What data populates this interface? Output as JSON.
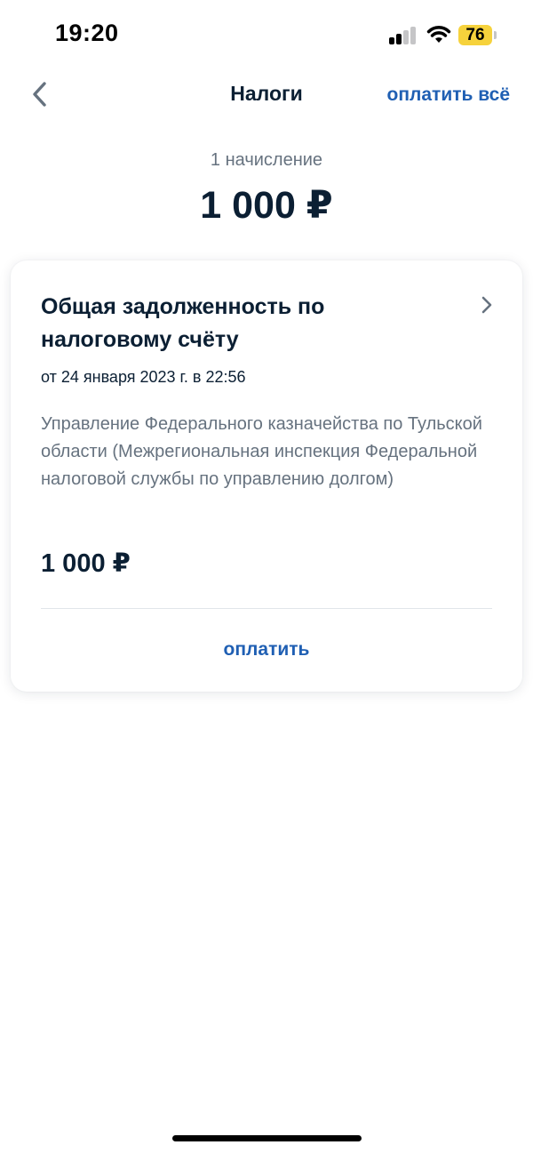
{
  "status_bar": {
    "time": "19:20",
    "battery_level": "76",
    "signal_bars_active": 2,
    "signal_bars_total": 4,
    "icons": [
      "cellular-signal-icon",
      "wifi-icon",
      "battery-icon"
    ],
    "battery_color": "#f6d23c"
  },
  "header": {
    "back_icon": "chevron-left-icon",
    "title": "Налоги",
    "pay_all_label": "оплатить всё"
  },
  "summary": {
    "accruals_label": "1 начисление",
    "total_amount": "1 000 ₽"
  },
  "charge": {
    "title": "Общая задолженность по налоговому счёту",
    "date": "от 24 января 2023 г. в 22:56",
    "recipient": "Управление Федерального казначейства по Тульской области (Межрегиональная инспекция Федеральной налоговой службы по управлению долгом)",
    "amount": "1 000 ₽",
    "pay_label": "оплатить",
    "chevron_icon": "chevron-right-icon"
  },
  "colors": {
    "accent": "#1f5fb3",
    "text_primary": "#0b1f33",
    "text_secondary": "#66727f",
    "background": "#ffffff"
  }
}
